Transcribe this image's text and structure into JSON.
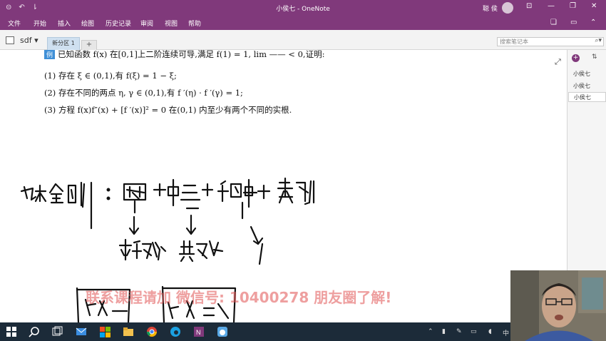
{
  "window": {
    "title": "小侯七 - OneNote",
    "user": "聪 侯"
  },
  "menu": [
    "文件",
    "开始",
    "插入",
    "绘图",
    "历史记录",
    "审阅",
    "视图",
    "帮助"
  ],
  "notebook": {
    "name": "sdf",
    "section": "新分区 1",
    "add_tab": "+"
  },
  "search": {
    "placeholder": "搜索笔记本"
  },
  "problem": {
    "badge": "例",
    "intro": "已知函数 f(x) 在[0,1]上二阶连续可导,满足 f(1) = 1, lim —— < 0,证明:",
    "items": [
      "(1) 存在 ξ ∈ (0,1),有 f(ξ) = 1 − ξ;",
      "(2) 存在不同的两点 η, γ ∈ (0,1),有 f ′(η) · f ′(γ) = 1;",
      "(3) 方程 f(x)f″(x) + [f ′(x)]² = 0 在(0,1) 内至少有两个不同的实根."
    ]
  },
  "pages": {
    "add": "+",
    "items": [
      "小侯七",
      "小侯七",
      "小侯七"
    ]
  },
  "watermark": "联系课程请加 微信号: 10400278 朋友圈了解!",
  "handwriting": {
    "line1": "九大金刚 : 罗尔 + 中三 + 积中 + 泰勒",
    "line2": "平移构造   共鸣构造"
  },
  "colors": {
    "accent": "#80397b",
    "watermark": "#e05050",
    "taskbar": "#1c2b39"
  }
}
